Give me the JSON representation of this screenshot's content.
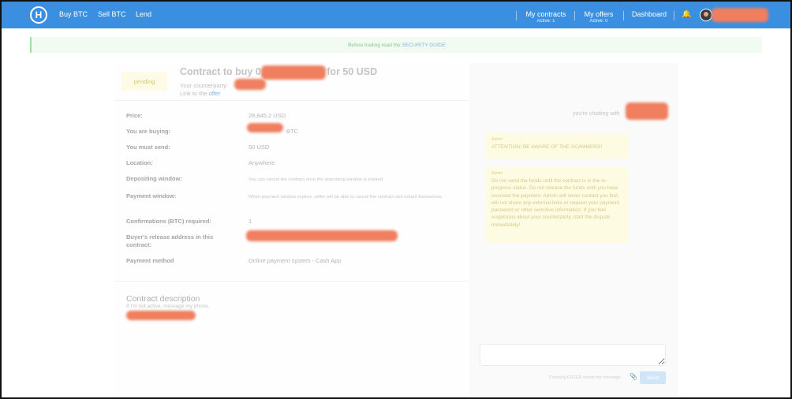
{
  "nav": {
    "logo": "H",
    "buy": "Buy BTC",
    "sell": "Sell BTC",
    "lend": "Lend",
    "my_contracts": "My contracts",
    "contracts_active": "Active: 1",
    "my_offers": "My offers",
    "offers_active": "Active: 0",
    "dashboard": "Dashboard",
    "icons": {
      "bell": "bell-icon",
      "avatar": "user-avatar"
    }
  },
  "banner": {
    "text": "Before trading read the",
    "link": "SECURITY GUIDE"
  },
  "contract": {
    "status": "pending",
    "title_prefix": "Contract to buy 0.",
    "title_suffix": "for 50 USD",
    "counterparty_label": "Your counterparty:",
    "link_prefix": "Link to the",
    "link_text": "offer",
    "rows": [
      {
        "label": "Price:",
        "value": "28,845.2 USD"
      },
      {
        "label": "You are buying:",
        "value": "BTC"
      },
      {
        "label": "You must send:",
        "value": "50 USD"
      },
      {
        "label": "Location:",
        "value": "Anywhere"
      },
      {
        "label": "Depositing window:",
        "value": "You can cancel the contract once the depositing window is expired"
      },
      {
        "label": "Payment window:",
        "value": "When payment window expires, seller will be able to cancel the contract and refund themselves."
      },
      {
        "label": "Confirmations (BTC) required:",
        "value": "1"
      },
      {
        "label": "Buyer's release address in this contract:",
        "value": ""
      },
      {
        "label": "Payment method",
        "value": "Online payment system - Cash App"
      }
    ],
    "description_title": "Contract description",
    "description_text": "If I'm not active, message my phone."
  },
  "chat": {
    "header": "you're chatting with",
    "messages": [
      {
        "sender": "Admin",
        "text": "ATTENTION! BE AWARE OF THE SCAMMERS!"
      },
      {
        "sender": "Admin",
        "text": "Do not send the funds until the contract is in the In-progress status. Do not release the funds until you have received the payment. Admin will never contact you first, will not share any external links or request your payment password or other sensitive information. If you feel suspicious about your counterparty, start the dispute immediately!"
      }
    ],
    "input_placeholder": "",
    "hint": "Pressing ENTER sends the message",
    "send": "Send"
  },
  "colors": {
    "nav": "#3b8fe0",
    "redaction": "#ef7f5f",
    "admin_msg_bg": "#fefbe3",
    "pending_bg": "#fdfae6"
  }
}
